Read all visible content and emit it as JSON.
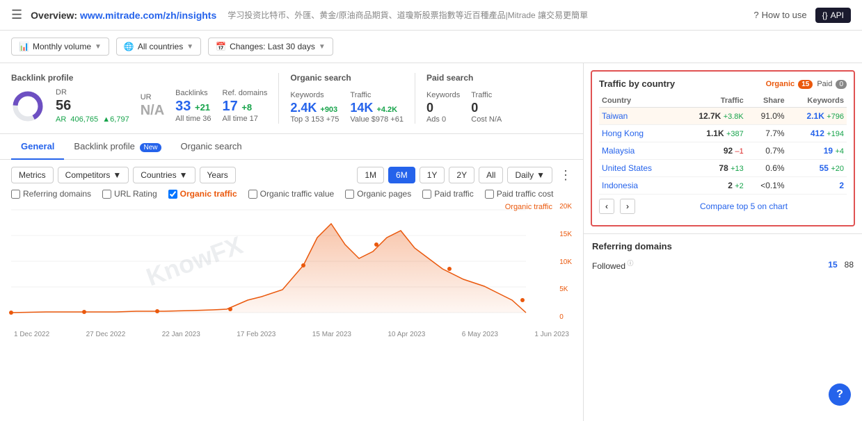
{
  "topnav": {
    "menu_icon": "☰",
    "title": "Overview:",
    "url": "www.mitrade.com/zh/insights",
    "subtitle": "学习投资比特币、外匯、黄金/原油商品期貨、道瓊斯股票指數等近百種產品|Mitrade 讓交易更簡單",
    "help_label": "How to use",
    "api_label": "API"
  },
  "filters": {
    "volume_label": "Monthly volume",
    "countries_label": "All countries",
    "changes_label": "Changes: Last 30 days"
  },
  "backlink_profile": {
    "title": "Backlink profile",
    "dr_label": "DR",
    "dr_value": "56",
    "ur_label": "UR",
    "ur_value": "N/A",
    "backlinks_label": "Backlinks",
    "backlinks_value": "33",
    "backlinks_delta": "+21",
    "backlinks_sub": "All time  36",
    "ref_domains_label": "Ref. domains",
    "ref_domains_value": "17",
    "ref_domains_delta": "+8",
    "ref_domains_sub": "All time  17",
    "ar_label": "AR",
    "ar_value": "406,765",
    "ar_delta": "▲6,797"
  },
  "organic_search": {
    "title": "Organic search",
    "keywords_label": "Keywords",
    "keywords_value": "2.4K",
    "keywords_delta": "+903",
    "keywords_sub": "Top 3  153  +75",
    "traffic_label": "Traffic",
    "traffic_value": "14K",
    "traffic_delta": "+4.2K",
    "traffic_sub": "Value  $978  +61"
  },
  "paid_search": {
    "title": "Paid search",
    "keywords_label": "Keywords",
    "keywords_value": "0",
    "keywords_sub": "Ads  0",
    "traffic_label": "Traffic",
    "traffic_value": "0",
    "traffic_sub": "Cost  N/A"
  },
  "tabs": {
    "general": "General",
    "backlink_profile": "Backlink profile",
    "new_badge": "New",
    "organic_search": "Organic search"
  },
  "chart_controls": {
    "metrics_label": "Metrics",
    "competitors_label": "Competitors",
    "countries_label": "Countries",
    "years_label": "Years",
    "period_1m": "1M",
    "period_6m": "6M",
    "period_1y": "1Y",
    "period_2y": "2Y",
    "period_all": "All",
    "interval_label": "Daily"
  },
  "chart_checkboxes": [
    {
      "label": "Referring domains",
      "checked": false,
      "color": "#555"
    },
    {
      "label": "URL Rating",
      "checked": false,
      "color": "#555"
    },
    {
      "label": "Organic traffic",
      "checked": true,
      "color": "#ea580c"
    },
    {
      "label": "Organic traffic value",
      "checked": false,
      "color": "#555"
    },
    {
      "label": "Organic pages",
      "checked": false,
      "color": "#555"
    },
    {
      "label": "Paid traffic",
      "checked": false,
      "color": "#555"
    },
    {
      "label": "Paid traffic cost",
      "checked": false,
      "color": "#555"
    }
  ],
  "chart": {
    "orange_label": "Organic traffic",
    "y_labels": [
      "20K",
      "15K",
      "10K",
      "5K",
      "0"
    ],
    "x_labels": [
      "1 Dec 2022",
      "27 Dec 2022",
      "22 Jan 2023",
      "17 Feb 2023",
      "15 Mar 2023",
      "10 Apr 2023",
      "6 May 2023",
      "1 Jun 2023"
    ]
  },
  "traffic_by_country": {
    "title": "Traffic by country",
    "organic_label": "Organic",
    "organic_count": "15",
    "paid_label": "Paid",
    "paid_count": "0",
    "columns": [
      "Country",
      "Traffic",
      "Share",
      "Keywords"
    ],
    "rows": [
      {
        "country": "Taiwan",
        "traffic": "12.7K",
        "delta": "+3.8K",
        "share": "91.0%",
        "kw": "2.1K",
        "kw_delta": "+796",
        "highlight": true
      },
      {
        "country": "Hong Kong",
        "traffic": "1.1K",
        "delta": "+387",
        "share": "7.7%",
        "kw": "412",
        "kw_delta": "+194",
        "highlight": false
      },
      {
        "country": "Malaysia",
        "traffic": "92",
        "delta": "–1",
        "share": "0.7%",
        "kw": "19",
        "kw_delta": "+4",
        "highlight": false
      },
      {
        "country": "United States",
        "traffic": "78",
        "delta": "+13",
        "share": "0.6%",
        "kw": "55",
        "kw_delta": "+20",
        "highlight": false
      },
      {
        "country": "Indonesia",
        "traffic": "2",
        "delta": "+2",
        "share": "<0.1%",
        "kw": "2",
        "kw_delta": "",
        "highlight": false
      }
    ],
    "compare_label": "Compare top 5 on chart"
  },
  "referring_domains": {
    "title": "Referring domains",
    "followed_label": "Followed",
    "followed_value": "15",
    "followed_value2": "88"
  }
}
